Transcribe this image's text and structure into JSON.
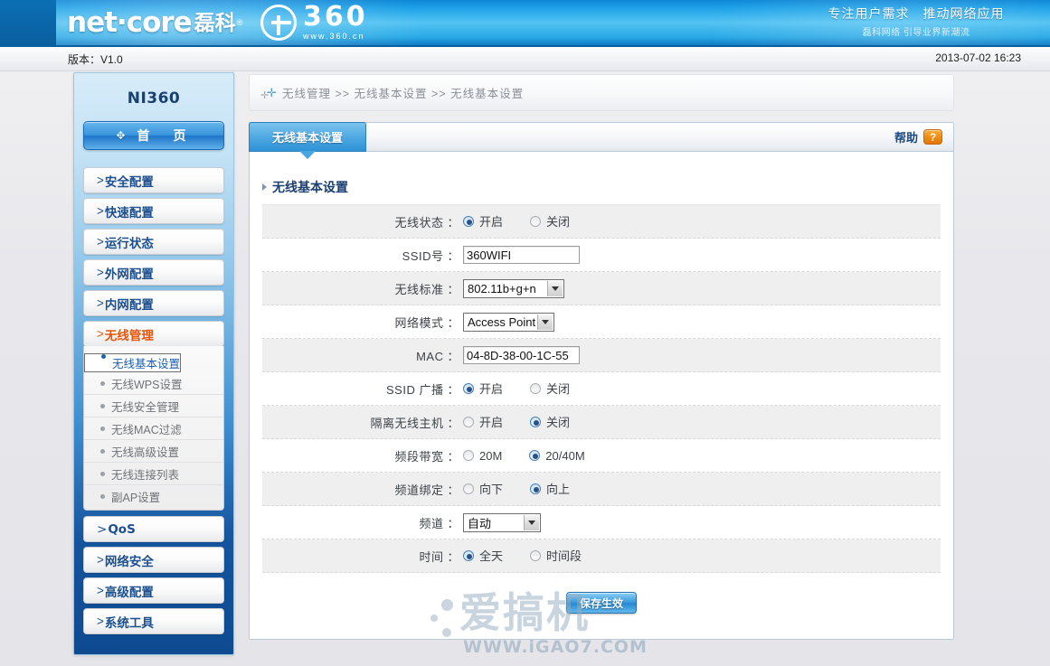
{
  "header": {
    "brand_net": "net·core",
    "brand_cn": "磊科",
    "brand_reg": "®",
    "logo_360_number": "360",
    "logo_360_url": "www.360.cn",
    "slogan_main": "专注用户需求　推动网络应用",
    "slogan_sub": "磊科网络  引导业界新潮流",
    "accent_color": "#1ea2e8"
  },
  "versionbar": {
    "version": "版本：V1.0",
    "datetime": "2013-07-02 16:23"
  },
  "sidebar": {
    "title": "NI360",
    "home_label": "首　页",
    "home_icon": "plus-icon",
    "items": [
      {
        "label": "安全配置",
        "active": false
      },
      {
        "label": "快速配置",
        "active": false
      },
      {
        "label": "运行状态",
        "active": false
      },
      {
        "label": "外网配置",
        "active": false
      },
      {
        "label": "内网配置",
        "active": false
      },
      {
        "label": "无线管理",
        "active": true
      },
      {
        "label": "QoS",
        "active": false
      },
      {
        "label": "网络安全",
        "active": false
      },
      {
        "label": "高级配置",
        "active": false
      },
      {
        "label": "系统工具",
        "active": false
      }
    ],
    "submenu": [
      {
        "label": "无线基本设置",
        "selected": true
      },
      {
        "label": "无线WPS设置",
        "selected": false
      },
      {
        "label": "无线安全管理",
        "selected": false
      },
      {
        "label": "无线MAC过滤",
        "selected": false
      },
      {
        "label": "无线高级设置",
        "selected": false
      },
      {
        "label": "无线连接列表",
        "selected": false
      },
      {
        "label": "副AP设置",
        "selected": false
      }
    ]
  },
  "breadcrumb": {
    "icon": "plus-plus-icon",
    "text": "无线管理  >>  无线基本设置  >>  无线基本设置"
  },
  "panel": {
    "tab_label": "无线基本设置",
    "help_label": "帮助",
    "help_icon": "question-mark-icon",
    "section_title": "无线基本设置",
    "save_label": "保存生效"
  },
  "form": {
    "wireless_status": {
      "label": "无线状态",
      "options": [
        "开启",
        "关闭"
      ],
      "selected": "开启"
    },
    "ssid": {
      "label": "SSID号",
      "value": "360WIFI",
      "placeholder": ""
    },
    "wireless_standard": {
      "label": "无线标准",
      "value": "802.11b+g+n",
      "options": [
        "802.11b+g+n"
      ]
    },
    "network_mode": {
      "label": "网络模式",
      "value": "Access Point",
      "options": [
        "Access Point"
      ]
    },
    "mac": {
      "label": "MAC",
      "value": "04-8D-38-00-1C-55",
      "placeholder": ""
    },
    "ssid_broadcast": {
      "label": "SSID 广播",
      "options": [
        "开启",
        "关闭"
      ],
      "selected": "开启"
    },
    "ap_isolation": {
      "label": "隔离无线主机",
      "options": [
        "开启",
        "关闭"
      ],
      "selected": "关闭"
    },
    "bandwidth": {
      "label": "频段带宽",
      "options": [
        "20M",
        "20/40M"
      ],
      "selected": "20/40M"
    },
    "channel_binding": {
      "label": "频道绑定",
      "options": [
        "向下",
        "向上"
      ],
      "selected": "向上"
    },
    "channel": {
      "label": "频道",
      "value": "自动",
      "options": [
        "自动"
      ]
    },
    "time": {
      "label": "时间",
      "options": [
        "全天",
        "时间段"
      ],
      "selected": "全天"
    }
  },
  "watermark": {
    "text_cn": "爱搞机",
    "text_url": "WWW.iGAO7.COM"
  }
}
